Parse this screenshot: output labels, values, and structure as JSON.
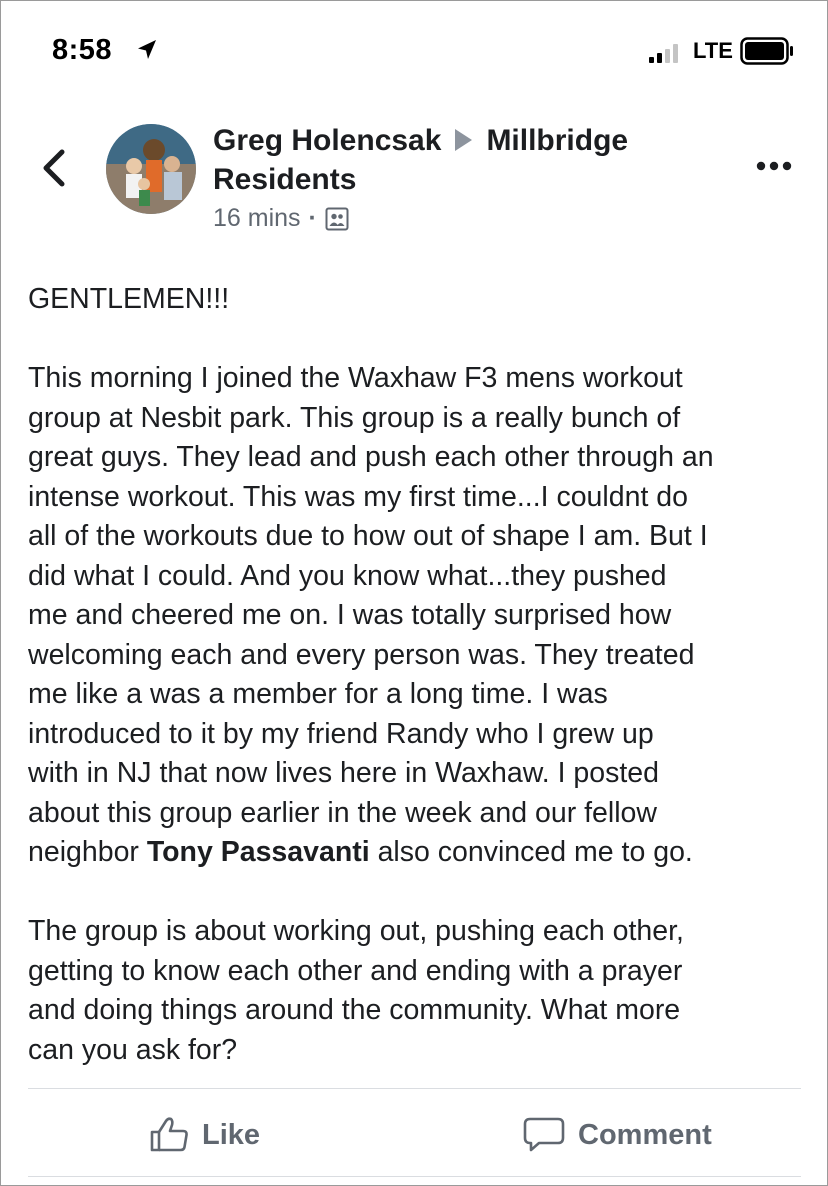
{
  "status_bar": {
    "time": "8:58",
    "network": "LTE"
  },
  "post": {
    "author": "Greg Holencsak",
    "group_line1": "Millbridge",
    "group_line2": "Residents",
    "timestamp": "16 mins",
    "meta_separator": "·",
    "audience_icon": "group-icon",
    "body": {
      "heading": "GENTLEMEN!!!",
      "p1_lines": [
        "This morning I joined the Waxhaw F3 mens workout",
        "group at Nesbit park. This group is a really bunch of",
        "great guys. They lead and push each other through an",
        "intense workout. This was my first time...I couldnt do",
        "all of the workouts due to how out of shape I am. But I",
        "did what I could. And you know what...they pushed",
        "me and cheered me on. I was totally surprised how",
        "welcoming each and every person was. They treated",
        "me like a was a member for a long time. I was",
        "introduced to it by my friend Randy who I grew up",
        "with in NJ that now lives here in Waxhaw. I posted",
        "about this group earlier in the week and our fellow"
      ],
      "p1_last_before": "neighbor ",
      "mention": "Tony Passavanti",
      "p1_last_after": " also convinced me to go.",
      "p2_lines": [
        "The group is about working out, pushing each other,",
        "getting to know each other and ending with a prayer",
        "and doing things around the community. What more",
        "can you ask for?"
      ]
    }
  },
  "actions": {
    "like": "Like",
    "comment": "Comment"
  },
  "colors": {
    "text": "#1c1e21",
    "secondary": "#606770",
    "divider": "#dadde1"
  }
}
